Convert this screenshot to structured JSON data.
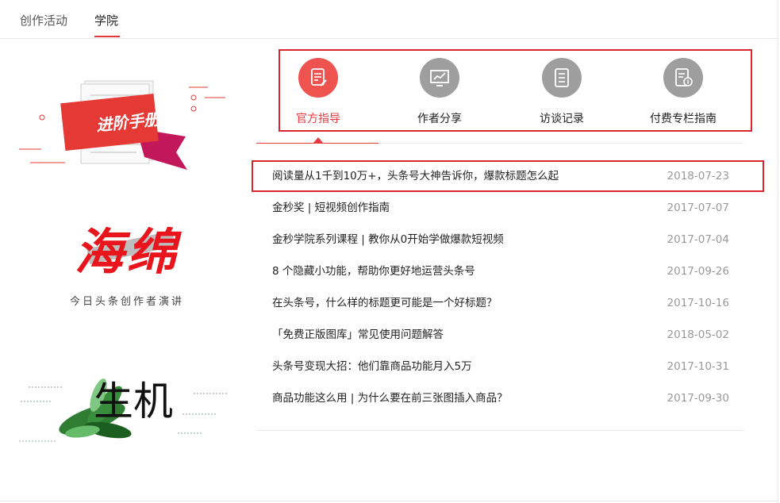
{
  "tabs": [
    {
      "label": "创作活动"
    },
    {
      "label": "学院"
    }
  ],
  "promos": {
    "handbook": {
      "text": "进阶手册"
    },
    "sponge": {
      "title": "海绵",
      "subtitle": "今日头条创作者演讲"
    },
    "vitality": {
      "text": "生机"
    }
  },
  "categories": [
    {
      "label": "官方指导",
      "icon": "edit-doc-icon",
      "color": "#ef5350"
    },
    {
      "label": "作者分享",
      "icon": "trend-board-icon",
      "color": "#9e9e9e"
    },
    {
      "label": "访谈记录",
      "icon": "notes-icon",
      "color": "#9e9e9e"
    },
    {
      "label": "付费专栏指南",
      "icon": "paid-doc-icon",
      "color": "#9e9e9e"
    }
  ],
  "articles": [
    {
      "title": "阅读量从1千到10万+，头条号大神告诉你，爆款标题怎么起",
      "date": "2018-07-23"
    },
    {
      "title": "金秒奖 | 短视频创作指南",
      "date": "2017-07-07"
    },
    {
      "title": "金秒学院系列课程 | 教你从0开始学做爆款短视频",
      "date": "2017-07-04"
    },
    {
      "title": "8 个隐藏小功能，帮助你更好地运营头条号",
      "date": "2017-09-26"
    },
    {
      "title": "在头条号，什么样的标题更可能是一个好标题？",
      "date": "2017-10-16"
    },
    {
      "title": "「免费正版图库」常见使用问题解答",
      "date": "2018-05-02"
    },
    {
      "title": "头条号变现大招：他们靠商品功能月入5万",
      "date": "2017-10-31"
    },
    {
      "title": "商品功能这么用 | 为什么要在前三张图插入商品？",
      "date": "2017-09-30"
    }
  ],
  "colors": {
    "accent": "#e5393d",
    "highlight_border": "#d8262c"
  }
}
